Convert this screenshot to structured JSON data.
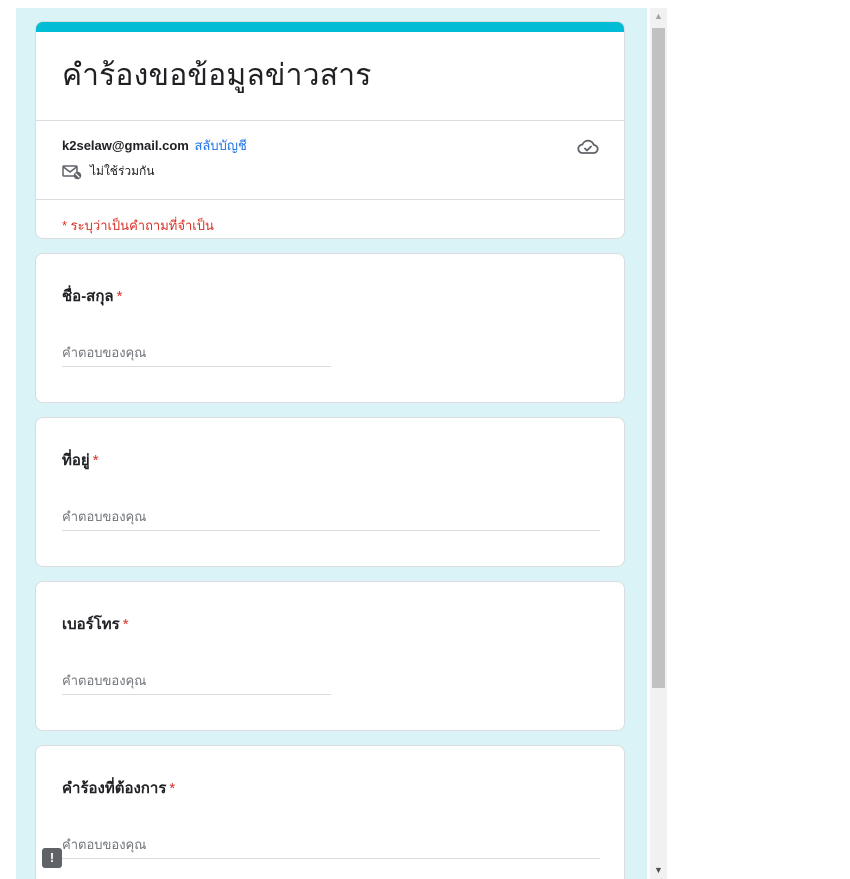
{
  "form": {
    "title": "คำร้องขอข้อมูลข่าวสาร",
    "account_email": "k2selaw@gmail.com",
    "switch_account_label": "สลับบัญชี",
    "not_shared_label": "ไม่ใช้ร่วมกัน",
    "required_note": "* ระบุว่าเป็นคำถามที่จำเป็น"
  },
  "questions": [
    {
      "label": "ชื่อ-สกุล",
      "required_mark": "*",
      "placeholder": "คำตอบของคุณ"
    },
    {
      "label": "ที่อยู่",
      "required_mark": "*",
      "placeholder": "คำตอบของคุณ"
    },
    {
      "label": "เบอร์โทร",
      "required_mark": "*",
      "placeholder": "คำตอบของคุณ"
    },
    {
      "label": "คำร้องที่ต้องการ",
      "required_mark": "*",
      "placeholder": "คำตอบของคุณ"
    }
  ],
  "colors": {
    "accent": "#00bcd4",
    "background": "#d9f3f7",
    "link": "#1a73e8",
    "required": "#d93025"
  },
  "icons": {
    "cloud": "cloud-check-icon",
    "not_shared": "mail-not-shared-icon",
    "feedback": "feedback-icon"
  },
  "feedback_glyph": "!"
}
